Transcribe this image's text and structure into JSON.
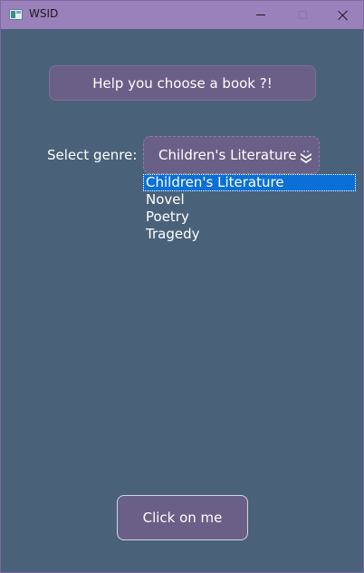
{
  "window": {
    "title": "WSID"
  },
  "main": {
    "help_button_label": "Help you choose a book ?!",
    "genre_label": "Select genre:",
    "genre_selected": "Children's Literature",
    "genre_options": [
      "Children's Literature",
      "Novel",
      "Poetry",
      "Tragedy"
    ],
    "click_button_label": "Click on me"
  },
  "colors": {
    "background": "#4a6279",
    "titlebar": "#9b81bb",
    "button_fill": "#6a6087",
    "selection": "#0a6fd6"
  },
  "icons": {
    "app": "app-icon",
    "minimize": "minimize-icon",
    "maximize": "maximize-icon",
    "close": "close-icon",
    "dropdown": "double-chevron-down-icon"
  }
}
